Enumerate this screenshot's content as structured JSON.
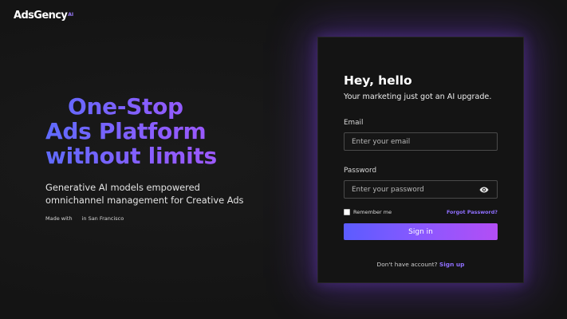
{
  "brand": {
    "name": "AdsGency",
    "suffix": "AI"
  },
  "hero": {
    "title_line1": "One-Stop",
    "title_line2": "Ads Platform",
    "title_line3": "without limits",
    "subtitle": "Generative AI models empowered omnichannel management for Creative Ads",
    "made_with_prefix": "Made with",
    "made_with_suffix": "in San Francisco"
  },
  "login": {
    "title": "Hey, hello",
    "subtitle": "Your marketing just got an AI upgrade.",
    "email_label": "Email",
    "email_placeholder": "Enter your email",
    "password_label": "Password",
    "password_placeholder": "Enter your password",
    "remember_label": "Remember me",
    "forgot_label": "Forgot Password?",
    "signin_label": "Sign in",
    "no_account_text": "Don't have account?",
    "signup_label": "Sign up"
  },
  "icons": {
    "password_toggle": "eye-icon"
  },
  "colors": {
    "background": "#141414",
    "accent": "#8f6fff",
    "gradient_start": "#5b5cff",
    "gradient_end": "#b34ef5"
  }
}
